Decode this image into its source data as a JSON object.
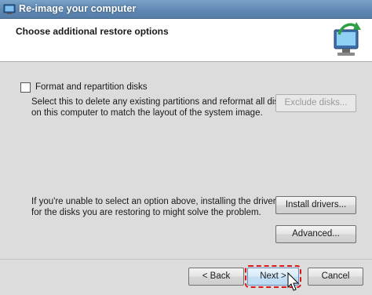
{
  "window": {
    "title": "Re-image your computer"
  },
  "header": {
    "title": "Choose additional restore options"
  },
  "format_option": {
    "label": "Format and repartition disks",
    "checked": false,
    "description_line1": "Select this to delete any existing partitions and reformat all disks",
    "description_line2": "on this computer to match the layout of the system image."
  },
  "buttons": {
    "exclude_disks": "Exclude disks...",
    "install_drivers": "Install drivers...",
    "advanced": "Advanced...",
    "back": "< Back",
    "next": "Next >",
    "cancel": "Cancel"
  },
  "drivers_note": {
    "line1": "If you're unable to select an option above, installing the drivers",
    "line2": "for the disks you are restoring to might solve the problem."
  },
  "icons": [
    "window-app-icon",
    "computer-restore-icon",
    "mouse-cursor-icon"
  ],
  "colors": {
    "titlebar": "#6a93bc",
    "focus_highlight": "#d81a1a"
  }
}
